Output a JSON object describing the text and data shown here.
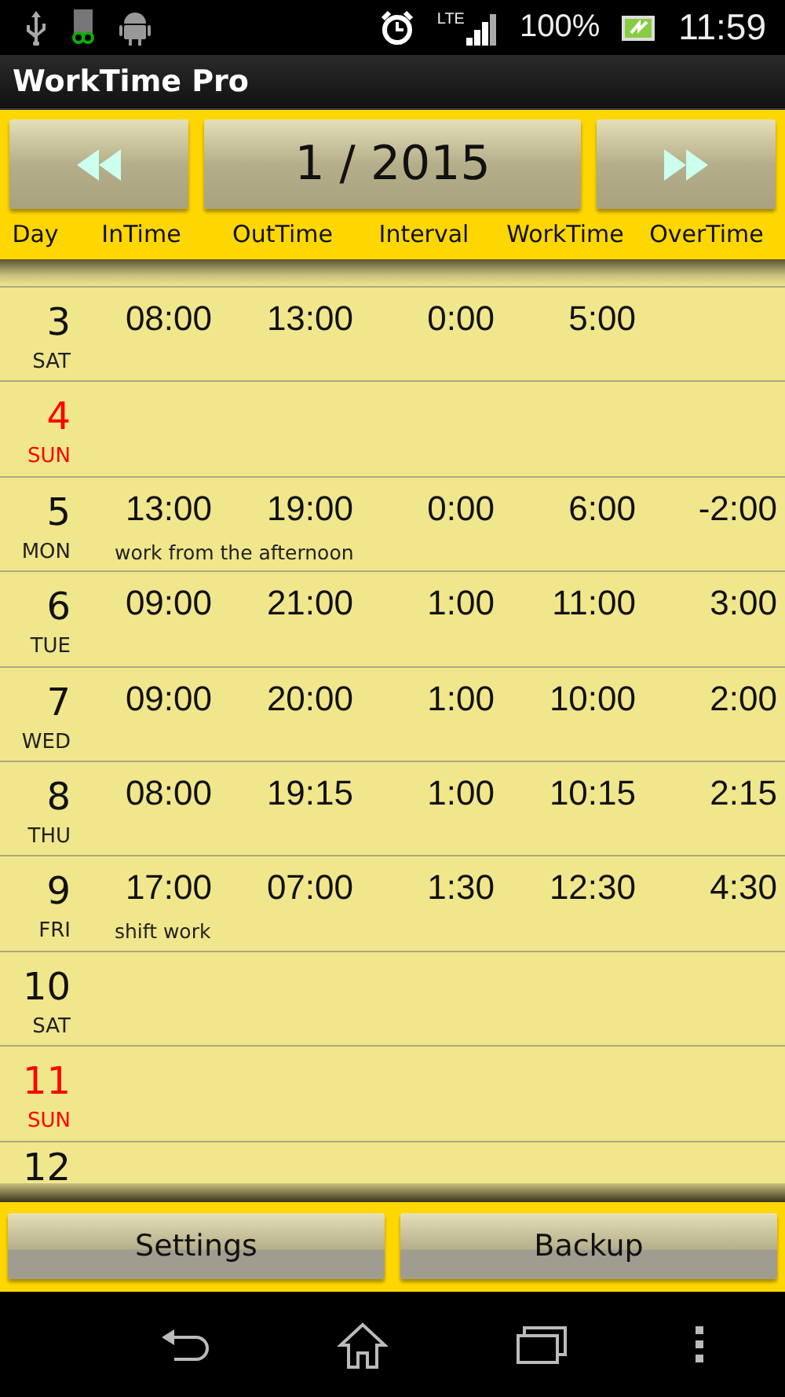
{
  "status_bar": {
    "network": "LTE",
    "battery": "100%",
    "time": "11:59"
  },
  "app_bar": {
    "title": "WorkTime Pro"
  },
  "month_nav": {
    "period": "1 / 2015"
  },
  "columns": [
    "Day",
    "InTime",
    "OutTime",
    "Interval",
    "WorkTime",
    "OverTime"
  ],
  "rows": [
    {
      "day": "3",
      "weekday": "SAT",
      "holiday": false,
      "in_time": "08:00",
      "out_time": "13:00",
      "interval": "0:00",
      "work_time": "5:00"
    },
    {
      "day": "4",
      "weekday": "SUN",
      "holiday": true
    },
    {
      "day": "5",
      "weekday": "MON",
      "holiday": false,
      "in_time": "13:00",
      "out_time": "19:00",
      "interval": "0:00",
      "work_time": "6:00",
      "over_time": "-2:00",
      "note": "work from the afternoon"
    },
    {
      "day": "6",
      "weekday": "TUE",
      "holiday": false,
      "in_time": "09:00",
      "out_time": "21:00",
      "interval": "1:00",
      "work_time": "11:00",
      "over_time": "3:00"
    },
    {
      "day": "7",
      "weekday": "WED",
      "holiday": false,
      "in_time": "09:00",
      "out_time": "20:00",
      "interval": "1:00",
      "work_time": "10:00",
      "over_time": "2:00"
    },
    {
      "day": "8",
      "weekday": "THU",
      "holiday": false,
      "in_time": "08:00",
      "out_time": "19:15",
      "interval": "1:00",
      "work_time": "10:15",
      "over_time": "2:15"
    },
    {
      "day": "9",
      "weekday": "FRI",
      "holiday": false,
      "in_time": "17:00",
      "out_time": "07:00",
      "interval": "1:30",
      "work_time": "12:30",
      "over_time": "4:30",
      "note": "shift work"
    },
    {
      "day": "10",
      "weekday": "SAT",
      "holiday": false
    },
    {
      "day": "11",
      "weekday": "SUN",
      "holiday": true
    },
    {
      "day": "12",
      "holiday": false
    }
  ],
  "buttons": [
    "Settings",
    "Backup"
  ]
}
